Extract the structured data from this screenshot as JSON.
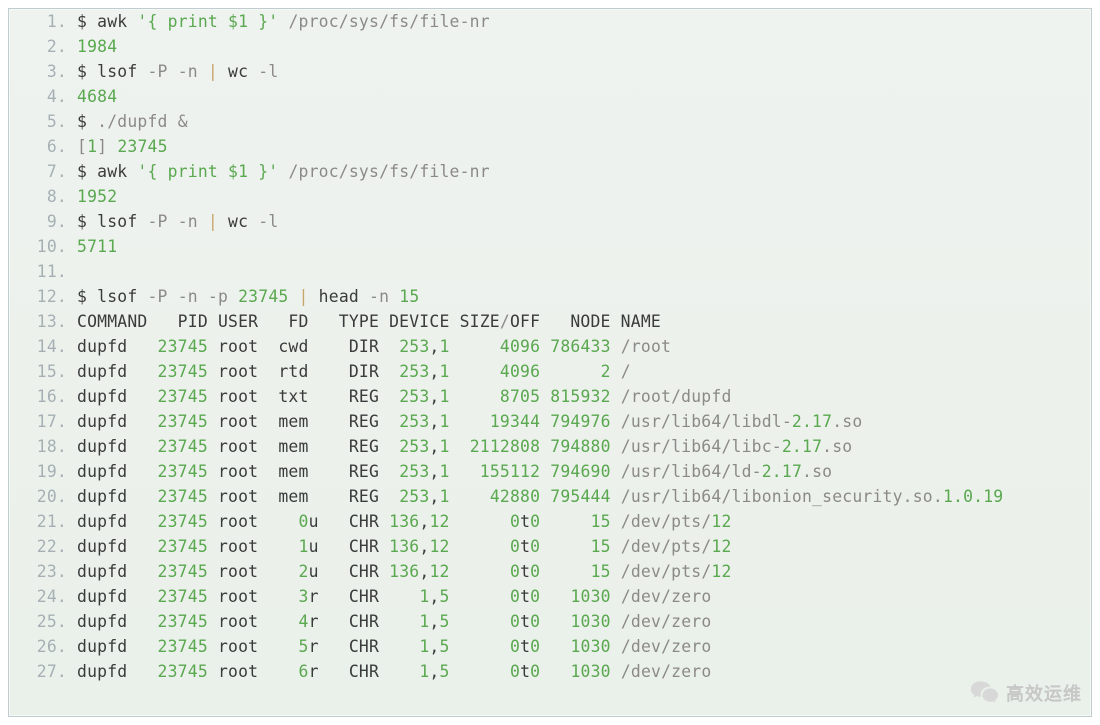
{
  "watermark": {
    "text": "高效运维"
  },
  "code": {
    "start_line": 1,
    "lines": [
      [
        [
          "default",
          "$ awk "
        ],
        [
          "string",
          "'{ print $1 }'"
        ],
        [
          "default",
          " "
        ],
        [
          "path",
          "/proc/sys/fs/file-nr"
        ]
      ],
      [
        [
          "number",
          "1984"
        ]
      ],
      [
        [
          "default",
          "$ lsof "
        ],
        [
          "dim",
          "-P -n"
        ],
        [
          "default",
          " "
        ],
        [
          "bar",
          "|"
        ],
        [
          "default",
          " wc "
        ],
        [
          "dim",
          "-l"
        ]
      ],
      [
        [
          "number",
          "4684"
        ]
      ],
      [
        [
          "default",
          "$ "
        ],
        [
          "path",
          "./dupfd"
        ],
        [
          "default",
          " "
        ],
        [
          "dim",
          "&"
        ]
      ],
      [
        [
          "bracket",
          "["
        ],
        [
          "number",
          "1"
        ],
        [
          "bracket",
          "]"
        ],
        [
          "default",
          " "
        ],
        [
          "number",
          "23745"
        ]
      ],
      [
        [
          "default",
          "$ awk "
        ],
        [
          "string",
          "'{ print $1 }'"
        ],
        [
          "default",
          " "
        ],
        [
          "path",
          "/proc/sys/fs/file-nr"
        ]
      ],
      [
        [
          "number",
          "1952"
        ]
      ],
      [
        [
          "default",
          "$ lsof "
        ],
        [
          "dim",
          "-P -n"
        ],
        [
          "default",
          " "
        ],
        [
          "bar",
          "|"
        ],
        [
          "default",
          " wc "
        ],
        [
          "dim",
          "-l"
        ]
      ],
      [
        [
          "number",
          "5711"
        ]
      ],
      [],
      [
        [
          "default",
          "$ lsof "
        ],
        [
          "dim",
          "-P -n -p"
        ],
        [
          "default",
          " "
        ],
        [
          "number",
          "23745"
        ],
        [
          "default",
          " "
        ],
        [
          "bar",
          "|"
        ],
        [
          "default",
          " head "
        ],
        [
          "dim",
          "-n"
        ],
        [
          "default",
          " "
        ],
        [
          "number",
          "15"
        ]
      ],
      [
        [
          "default",
          "COMMAND   PID USER   FD   TYPE DEVICE SIZE"
        ],
        [
          "path",
          "/"
        ],
        [
          "default",
          "OFF   NODE NAME"
        ]
      ],
      [
        [
          "default",
          "dupfd   "
        ],
        [
          "number",
          "23745"
        ],
        [
          "default",
          " root  cwd    DIR  "
        ],
        [
          "number",
          "253"
        ],
        [
          "default",
          ","
        ],
        [
          "number",
          "1"
        ],
        [
          "default",
          "     "
        ],
        [
          "number",
          "4096"
        ],
        [
          "default",
          " "
        ],
        [
          "number",
          "786433"
        ],
        [
          "default",
          " "
        ],
        [
          "path",
          "/root"
        ]
      ],
      [
        [
          "default",
          "dupfd   "
        ],
        [
          "number",
          "23745"
        ],
        [
          "default",
          " root  rtd    DIR  "
        ],
        [
          "number",
          "253"
        ],
        [
          "default",
          ","
        ],
        [
          "number",
          "1"
        ],
        [
          "default",
          "     "
        ],
        [
          "number",
          "4096"
        ],
        [
          "default",
          "      "
        ],
        [
          "number",
          "2"
        ],
        [
          "default",
          " "
        ],
        [
          "path",
          "/"
        ]
      ],
      [
        [
          "default",
          "dupfd   "
        ],
        [
          "number",
          "23745"
        ],
        [
          "default",
          " root  txt    REG  "
        ],
        [
          "number",
          "253"
        ],
        [
          "default",
          ","
        ],
        [
          "number",
          "1"
        ],
        [
          "default",
          "     "
        ],
        [
          "number",
          "8705"
        ],
        [
          "default",
          " "
        ],
        [
          "number",
          "815932"
        ],
        [
          "default",
          " "
        ],
        [
          "path",
          "/root/dupfd"
        ]
      ],
      [
        [
          "default",
          "dupfd   "
        ],
        [
          "number",
          "23745"
        ],
        [
          "default",
          " root  mem    REG  "
        ],
        [
          "number",
          "253"
        ],
        [
          "default",
          ","
        ],
        [
          "number",
          "1"
        ],
        [
          "default",
          "    "
        ],
        [
          "number",
          "19344"
        ],
        [
          "default",
          " "
        ],
        [
          "number",
          "794976"
        ],
        [
          "default",
          " "
        ],
        [
          "path",
          "/usr/lib64/libdl-"
        ],
        [
          "number",
          "2.17"
        ],
        [
          "path",
          ".so"
        ]
      ],
      [
        [
          "default",
          "dupfd   "
        ],
        [
          "number",
          "23745"
        ],
        [
          "default",
          " root  mem    REG  "
        ],
        [
          "number",
          "253"
        ],
        [
          "default",
          ","
        ],
        [
          "number",
          "1"
        ],
        [
          "default",
          "  "
        ],
        [
          "number",
          "2112808"
        ],
        [
          "default",
          " "
        ],
        [
          "number",
          "794880"
        ],
        [
          "default",
          " "
        ],
        [
          "path",
          "/usr/lib64/libc-"
        ],
        [
          "number",
          "2.17"
        ],
        [
          "path",
          ".so"
        ]
      ],
      [
        [
          "default",
          "dupfd   "
        ],
        [
          "number",
          "23745"
        ],
        [
          "default",
          " root  mem    REG  "
        ],
        [
          "number",
          "253"
        ],
        [
          "default",
          ","
        ],
        [
          "number",
          "1"
        ],
        [
          "default",
          "   "
        ],
        [
          "number",
          "155112"
        ],
        [
          "default",
          " "
        ],
        [
          "number",
          "794690"
        ],
        [
          "default",
          " "
        ],
        [
          "path",
          "/usr/lib64/ld-"
        ],
        [
          "number",
          "2.17"
        ],
        [
          "path",
          ".so"
        ]
      ],
      [
        [
          "default",
          "dupfd   "
        ],
        [
          "number",
          "23745"
        ],
        [
          "default",
          " root  mem    REG  "
        ],
        [
          "number",
          "253"
        ],
        [
          "default",
          ","
        ],
        [
          "number",
          "1"
        ],
        [
          "default",
          "    "
        ],
        [
          "number",
          "42880"
        ],
        [
          "default",
          " "
        ],
        [
          "number",
          "795444"
        ],
        [
          "default",
          " "
        ],
        [
          "path",
          "/usr/lib64/libonion_security.so."
        ],
        [
          "number",
          "1.0.19"
        ]
      ],
      [
        [
          "default",
          "dupfd   "
        ],
        [
          "number",
          "23745"
        ],
        [
          "default",
          " root    "
        ],
        [
          "number",
          "0"
        ],
        [
          "default",
          "u   CHR "
        ],
        [
          "number",
          "136"
        ],
        [
          "default",
          ","
        ],
        [
          "number",
          "12"
        ],
        [
          "default",
          "      "
        ],
        [
          "number",
          "0"
        ],
        [
          "default",
          "t"
        ],
        [
          "number",
          "0"
        ],
        [
          "default",
          "     "
        ],
        [
          "number",
          "15"
        ],
        [
          "default",
          " "
        ],
        [
          "path",
          "/dev/pts/"
        ],
        [
          "number",
          "12"
        ]
      ],
      [
        [
          "default",
          "dupfd   "
        ],
        [
          "number",
          "23745"
        ],
        [
          "default",
          " root    "
        ],
        [
          "number",
          "1"
        ],
        [
          "default",
          "u   CHR "
        ],
        [
          "number",
          "136"
        ],
        [
          "default",
          ","
        ],
        [
          "number",
          "12"
        ],
        [
          "default",
          "      "
        ],
        [
          "number",
          "0"
        ],
        [
          "default",
          "t"
        ],
        [
          "number",
          "0"
        ],
        [
          "default",
          "     "
        ],
        [
          "number",
          "15"
        ],
        [
          "default",
          " "
        ],
        [
          "path",
          "/dev/pts/"
        ],
        [
          "number",
          "12"
        ]
      ],
      [
        [
          "default",
          "dupfd   "
        ],
        [
          "number",
          "23745"
        ],
        [
          "default",
          " root    "
        ],
        [
          "number",
          "2"
        ],
        [
          "default",
          "u   CHR "
        ],
        [
          "number",
          "136"
        ],
        [
          "default",
          ","
        ],
        [
          "number",
          "12"
        ],
        [
          "default",
          "      "
        ],
        [
          "number",
          "0"
        ],
        [
          "default",
          "t"
        ],
        [
          "number",
          "0"
        ],
        [
          "default",
          "     "
        ],
        [
          "number",
          "15"
        ],
        [
          "default",
          " "
        ],
        [
          "path",
          "/dev/pts/"
        ],
        [
          "number",
          "12"
        ]
      ],
      [
        [
          "default",
          "dupfd   "
        ],
        [
          "number",
          "23745"
        ],
        [
          "default",
          " root    "
        ],
        [
          "number",
          "3"
        ],
        [
          "default",
          "r   CHR    "
        ],
        [
          "number",
          "1"
        ],
        [
          "default",
          ","
        ],
        [
          "number",
          "5"
        ],
        [
          "default",
          "      "
        ],
        [
          "number",
          "0"
        ],
        [
          "default",
          "t"
        ],
        [
          "number",
          "0"
        ],
        [
          "default",
          "   "
        ],
        [
          "number",
          "1030"
        ],
        [
          "default",
          " "
        ],
        [
          "path",
          "/dev/zero"
        ]
      ],
      [
        [
          "default",
          "dupfd   "
        ],
        [
          "number",
          "23745"
        ],
        [
          "default",
          " root    "
        ],
        [
          "number",
          "4"
        ],
        [
          "default",
          "r   CHR    "
        ],
        [
          "number",
          "1"
        ],
        [
          "default",
          ","
        ],
        [
          "number",
          "5"
        ],
        [
          "default",
          "      "
        ],
        [
          "number",
          "0"
        ],
        [
          "default",
          "t"
        ],
        [
          "number",
          "0"
        ],
        [
          "default",
          "   "
        ],
        [
          "number",
          "1030"
        ],
        [
          "default",
          " "
        ],
        [
          "path",
          "/dev/zero"
        ]
      ],
      [
        [
          "default",
          "dupfd   "
        ],
        [
          "number",
          "23745"
        ],
        [
          "default",
          " root    "
        ],
        [
          "number",
          "5"
        ],
        [
          "default",
          "r   CHR    "
        ],
        [
          "number",
          "1"
        ],
        [
          "default",
          ","
        ],
        [
          "number",
          "5"
        ],
        [
          "default",
          "      "
        ],
        [
          "number",
          "0"
        ],
        [
          "default",
          "t"
        ],
        [
          "number",
          "0"
        ],
        [
          "default",
          "   "
        ],
        [
          "number",
          "1030"
        ],
        [
          "default",
          " "
        ],
        [
          "path",
          "/dev/zero"
        ]
      ],
      [
        [
          "default",
          "dupfd   "
        ],
        [
          "number",
          "23745"
        ],
        [
          "default",
          " root    "
        ],
        [
          "number",
          "6"
        ],
        [
          "default",
          "r   CHR    "
        ],
        [
          "number",
          "1"
        ],
        [
          "default",
          ","
        ],
        [
          "number",
          "5"
        ],
        [
          "default",
          "      "
        ],
        [
          "number",
          "0"
        ],
        [
          "default",
          "t"
        ],
        [
          "number",
          "0"
        ],
        [
          "default",
          "   "
        ],
        [
          "number",
          "1030"
        ],
        [
          "default",
          " "
        ],
        [
          "path",
          "/dev/zero"
        ]
      ]
    ]
  }
}
